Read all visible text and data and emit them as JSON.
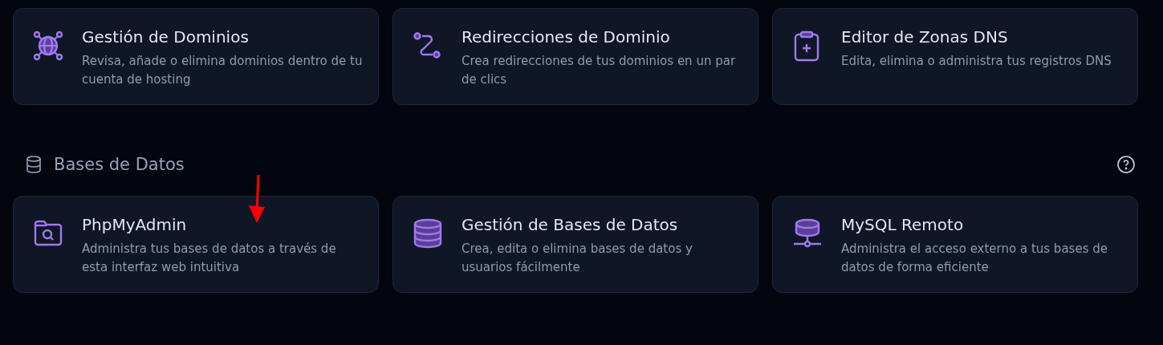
{
  "sections": [
    {
      "cards": [
        {
          "kind": "globe",
          "title": "Gestión de Dominios",
          "description": "Revisa, añade o elimina dominios dentro de tu cuenta de hosting"
        },
        {
          "kind": "route",
          "title": "Redirecciones de Dominio",
          "description": "Crea redirecciones de tus dominios en un par de clics"
        },
        {
          "kind": "clipboard",
          "title": "Editor de Zonas DNS",
          "description": "Edita, elimina o administra tus registros DNS"
        }
      ]
    },
    {
      "title": "Bases de Datos",
      "help": true,
      "cards": [
        {
          "kind": "folder-search",
          "title": "PhpMyAdmin",
          "description": "Administra tus bases de datos a través de esta interfaz web intuitiva"
        },
        {
          "kind": "database",
          "title": "Gestión de Bases de Datos",
          "description": "Crea, edita o elimina bases de datos y usuarios fácilmente"
        },
        {
          "kind": "server",
          "title": "MySQL Remoto",
          "description": "Administra el acceso externo a tus bases de datos de forma eficiente"
        }
      ]
    }
  ],
  "pointer_arrow": {
    "color": "#ff0000"
  }
}
